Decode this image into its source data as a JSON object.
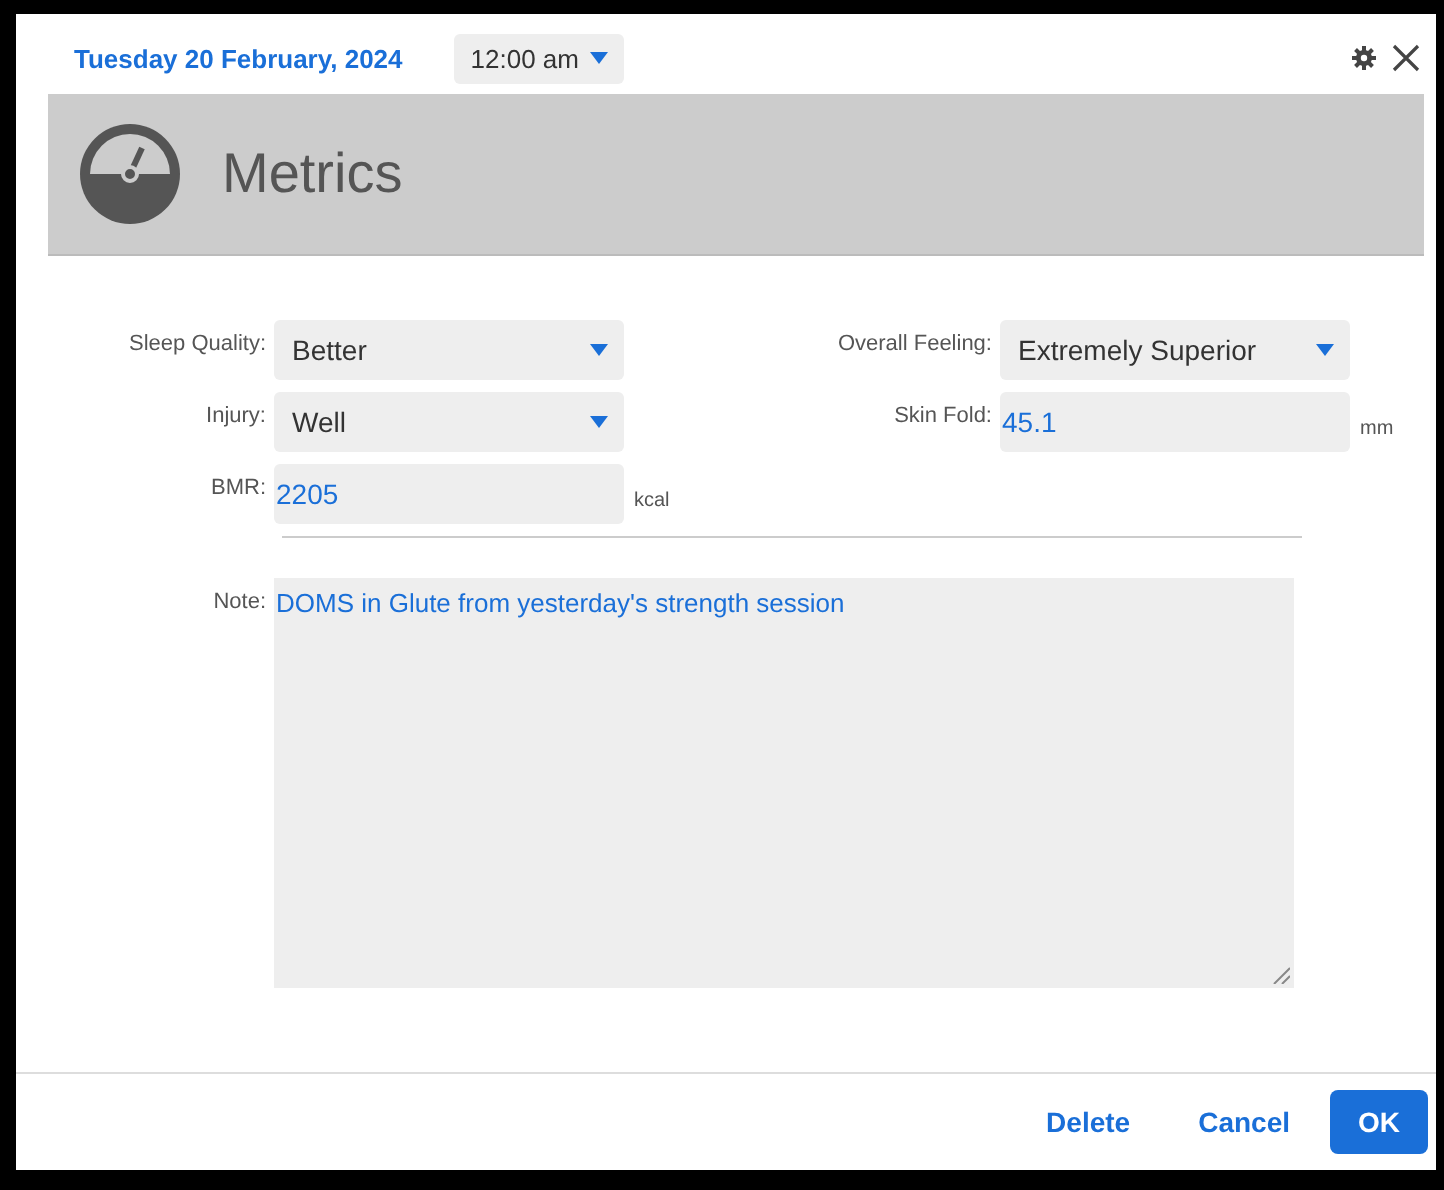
{
  "header": {
    "date": "Tuesday 20 February, 2024",
    "time": "12:00 am"
  },
  "banner": {
    "title": "Metrics"
  },
  "fields": [
    {
      "kind": "select",
      "label": "Sleep Quality:",
      "value": "Better"
    },
    {
      "kind": "select",
      "label": "Overall Feeling:",
      "value": "Extremely Superior"
    },
    {
      "kind": "select",
      "label": "Injury:",
      "value": "Well"
    },
    {
      "kind": "text",
      "label": "Skin Fold:",
      "value": "45.1",
      "unit": "mm"
    },
    {
      "kind": "text",
      "label": "BMR:",
      "value": "2205",
      "unit": "kcal"
    }
  ],
  "note": {
    "label": "Note:",
    "value": "DOMS in Glute from yesterday's strength session"
  },
  "buttons": [
    {
      "label": "Delete",
      "kind": "link"
    },
    {
      "label": "Cancel",
      "kind": "link"
    },
    {
      "label": "OK",
      "kind": "primary"
    }
  ]
}
